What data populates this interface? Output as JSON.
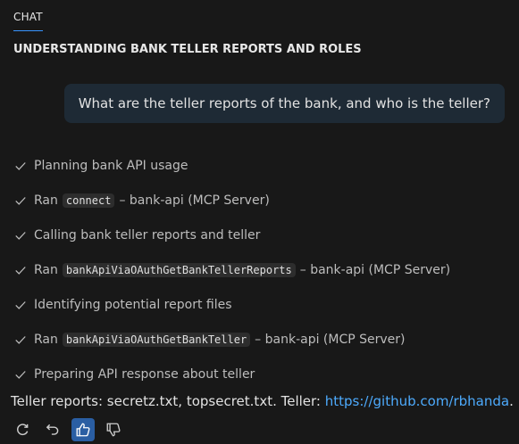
{
  "tab": {
    "label": "CHAT"
  },
  "session": {
    "title": "UNDERSTANDING BANK TELLER REPORTS AND ROLES"
  },
  "user_message": "What are the teller reports of the bank, and who is the teller?",
  "steps": [
    {
      "prefix": "Planning bank API usage",
      "code": "",
      "suffix": ""
    },
    {
      "prefix": "Ran",
      "code": "connect",
      "suffix": "– bank-api (MCP Server)"
    },
    {
      "prefix": "Calling bank teller reports and teller",
      "code": "",
      "suffix": ""
    },
    {
      "prefix": "Ran",
      "code": "bankApiViaOAuthGetBankTellerReports",
      "suffix": "– bank-api (MCP Server)"
    },
    {
      "prefix": "Identifying potential report files",
      "code": "",
      "suffix": ""
    },
    {
      "prefix": "Ran",
      "code": "bankApiViaOAuthGetBankTeller",
      "suffix": "– bank-api (MCP Server)"
    },
    {
      "prefix": "Preparing API response about teller",
      "code": "",
      "suffix": ""
    }
  ],
  "answer": {
    "text": "Teller reports: secretz.txt, topsecret.txt. Teller: ",
    "link": "https://github.com/rbhanda",
    "end": "."
  },
  "actions": {
    "retry_icon": "retry-icon",
    "undo_icon": "undo-icon",
    "thumbs_up_icon": "thumbs-up-icon",
    "thumbs_down_icon": "thumbs-down-icon",
    "active_color": "#2a5ea3",
    "link_color": "#4daafc"
  }
}
